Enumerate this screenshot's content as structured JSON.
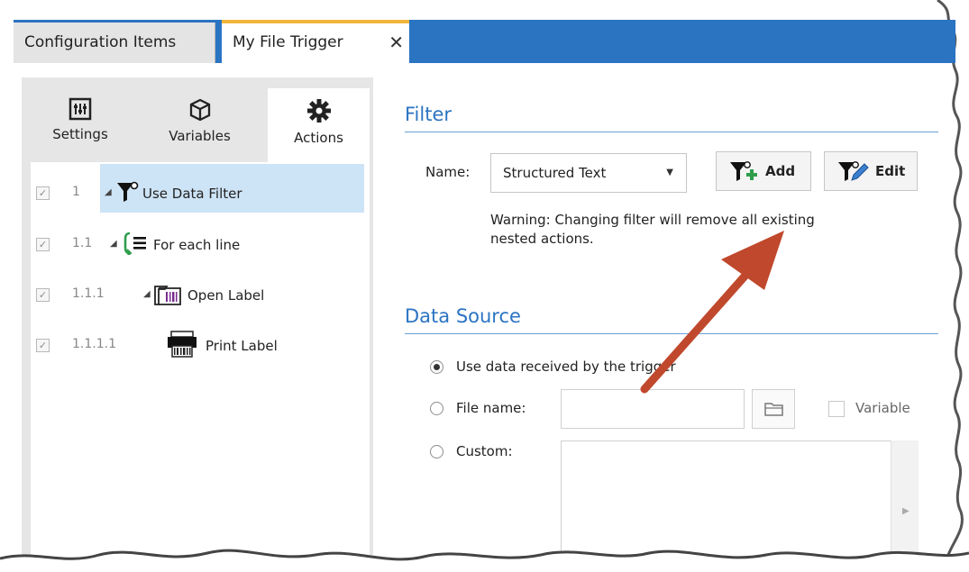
{
  "tabs": {
    "config_label": "Configuration Items",
    "active_label": "My File Trigger",
    "close_glyph": "✕"
  },
  "panel_tabs": [
    {
      "label": "Settings",
      "icon": "settings-sliders-icon"
    },
    {
      "label": "Variables",
      "icon": "cube-icon"
    },
    {
      "label": "Actions",
      "icon": "gear-icon"
    }
  ],
  "tree": [
    {
      "number": "1",
      "label": "Use Data Filter",
      "icon": "filter-icon",
      "checked": true,
      "selected": true
    },
    {
      "number": "1.1",
      "label": "For each line",
      "icon": "loop-icon",
      "checked": true,
      "selected": false
    },
    {
      "number": "1.1.1",
      "label": "Open Label",
      "icon": "open-label-icon",
      "checked": true,
      "selected": false
    },
    {
      "number": "1.1.1.1",
      "label": "Print Label",
      "icon": "printer-icon",
      "checked": true,
      "selected": false
    }
  ],
  "filter": {
    "title": "Filter",
    "name_label": "Name:",
    "selected": "Structured Text",
    "add_label": "Add",
    "edit_label": "Edit",
    "warning_line1": "Warning: Changing filter will remove all existing",
    "warning_line2": "nested actions."
  },
  "data_source": {
    "title": "Data Source",
    "option_trigger": "Use data received by the trigger",
    "option_file": "File name:",
    "option_custom": "Custom:",
    "variable_label": "Variable",
    "selected_option": "trigger"
  },
  "colors": {
    "accent": "#2b74c2",
    "tab_highlight": "#f2b43d",
    "selection": "#cde3f6",
    "annotation_arrow": "#c0482c"
  }
}
